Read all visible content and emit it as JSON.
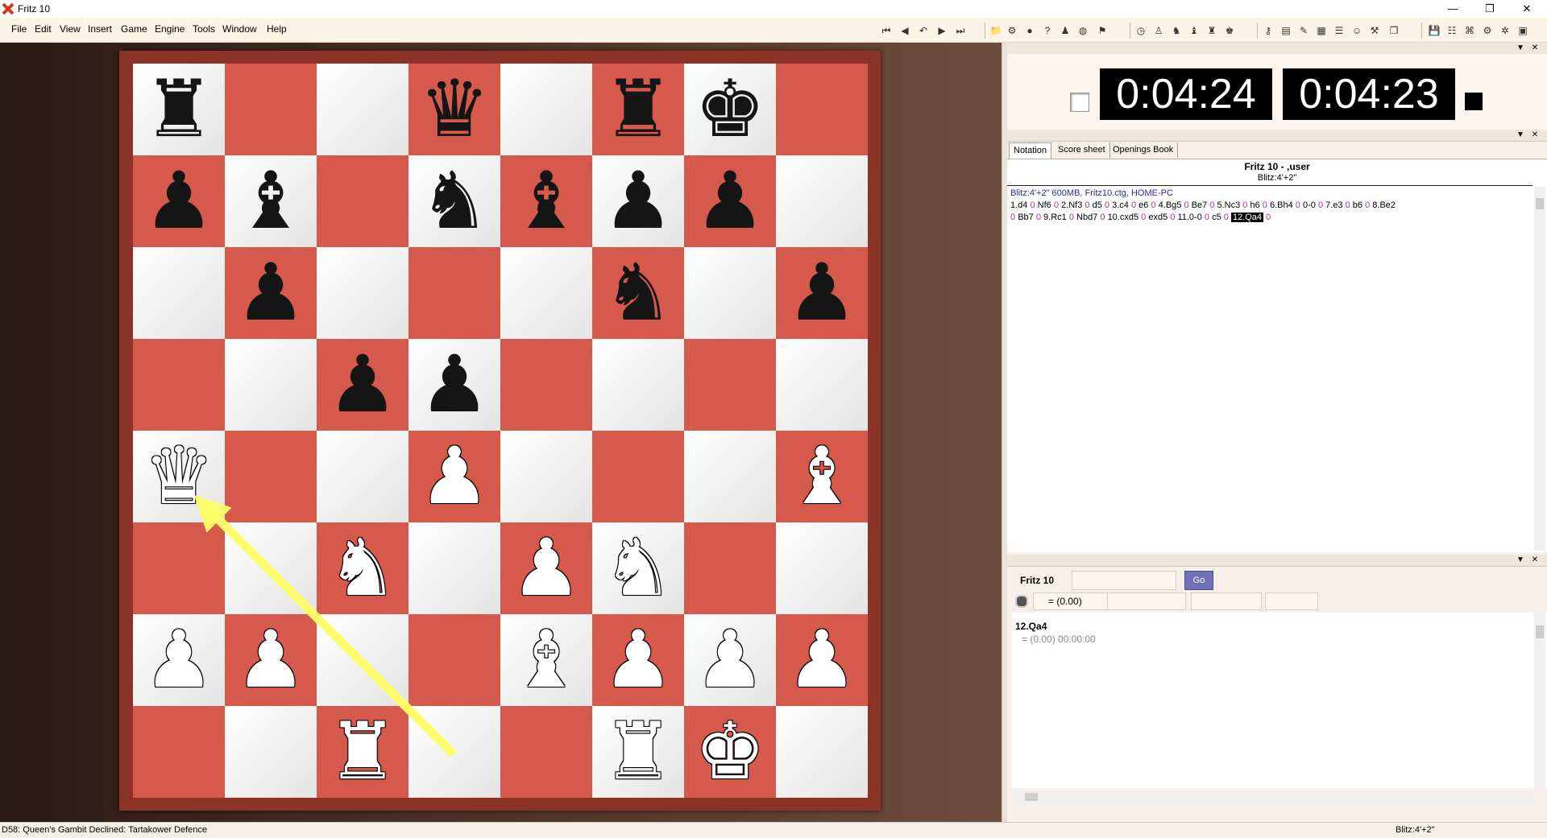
{
  "window": {
    "title": "Fritz 10",
    "controls": [
      "—",
      "❐",
      "✕"
    ]
  },
  "menu": [
    "File",
    "Edit",
    "View",
    "Insert",
    "Game",
    "Engine",
    "Tools",
    "Window",
    "Help"
  ],
  "board": {
    "ranks": [
      [
        "♜",
        "",
        "",
        "♛",
        "",
        "♜",
        "♚",
        ""
      ],
      [
        "♟",
        "♝",
        "",
        "♞",
        "♝",
        "♟",
        "♟",
        ""
      ],
      [
        "",
        "♟",
        "",
        "",
        "",
        "♞",
        "",
        "♟"
      ],
      [
        "",
        "",
        "♟",
        "♟",
        "",
        "",
        "",
        ""
      ],
      [
        "♛",
        "",
        "",
        "♟",
        "",
        "",
        "",
        "♝"
      ],
      [
        "",
        "",
        "♞",
        "",
        "♟",
        "♞",
        "",
        ""
      ],
      [
        "♟",
        "♟",
        "",
        "",
        "♝",
        "♟",
        "♟",
        "♟"
      ],
      [
        "",
        "",
        "♜",
        "",
        "",
        "♜",
        "♚",
        ""
      ]
    ],
    "colors": [
      [
        "b",
        "",
        "",
        "b",
        "",
        "b",
        "b",
        ""
      ],
      [
        "b",
        "b",
        "",
        "b",
        "b",
        "b",
        "b",
        ""
      ],
      [
        "",
        "b",
        "",
        "",
        "",
        "b",
        "",
        "b"
      ],
      [
        "",
        "",
        "b",
        "b",
        "",
        "",
        "",
        ""
      ],
      [
        "w",
        "",
        "",
        "w",
        "",
        "",
        "",
        "w"
      ],
      [
        "",
        "",
        "w",
        "",
        "w",
        "w",
        "",
        ""
      ],
      [
        "w",
        "w",
        "",
        "",
        "w",
        "w",
        "w",
        "w"
      ],
      [
        "",
        "",
        "w",
        "",
        "",
        "w",
        "w",
        ""
      ]
    ],
    "last_move": {
      "from": "d1",
      "to": "a4",
      "arrow_color": "#ffff66"
    }
  },
  "clocks": {
    "white": "0:04:24",
    "black": "0:04:23"
  },
  "tabs": [
    "Notation",
    "Score sheet",
    "Openings Book"
  ],
  "notation": {
    "header_players": "Fritz 10 - ,user",
    "header_event": "Blitz:4'+2\"",
    "info": "Blitz:4'+2\"  600MB, Fritz10.ctg, HOME-PC",
    "line1": [
      [
        "1.d4",
        "0"
      ],
      [
        "Nf6",
        "0"
      ],
      [
        "2.Nf3",
        "0"
      ],
      [
        "d5",
        "0"
      ],
      [
        "3.c4",
        "0"
      ],
      [
        "e6",
        "0"
      ],
      [
        "4.Bg5",
        "0"
      ],
      [
        "Be7",
        "0"
      ],
      [
        "5.Nc3",
        "0"
      ],
      [
        "h6",
        "0"
      ],
      [
        "6.Bh4",
        "0"
      ],
      [
        "0-0",
        "0"
      ],
      [
        "7.e3",
        "0"
      ],
      [
        "b6",
        "0"
      ],
      [
        "8.Be2",
        ""
      ]
    ],
    "line2_start_zero": "0",
    "line2": [
      [
        "Bb7",
        "0"
      ],
      [
        "9.Rc1",
        "0"
      ],
      [
        "Nbd7",
        "0"
      ],
      [
        "10.cxd5",
        "0"
      ],
      [
        "exd5",
        "0"
      ],
      [
        "11.0-0",
        "0"
      ],
      [
        "c5",
        "0"
      ]
    ],
    "current_move": "12.Qa4",
    "current_zero": "0"
  },
  "engine": {
    "name": "Fritz 10",
    "go_label": "Go",
    "eval": "=  (0.00)",
    "line_move": "12.Qa4",
    "line_eval": "=  (0.00)    00:00:00"
  },
  "status": {
    "opening": "D58: Queen's Gambit Declined: Tartakower Defence",
    "time_control": "Blitz:4'+2\""
  }
}
